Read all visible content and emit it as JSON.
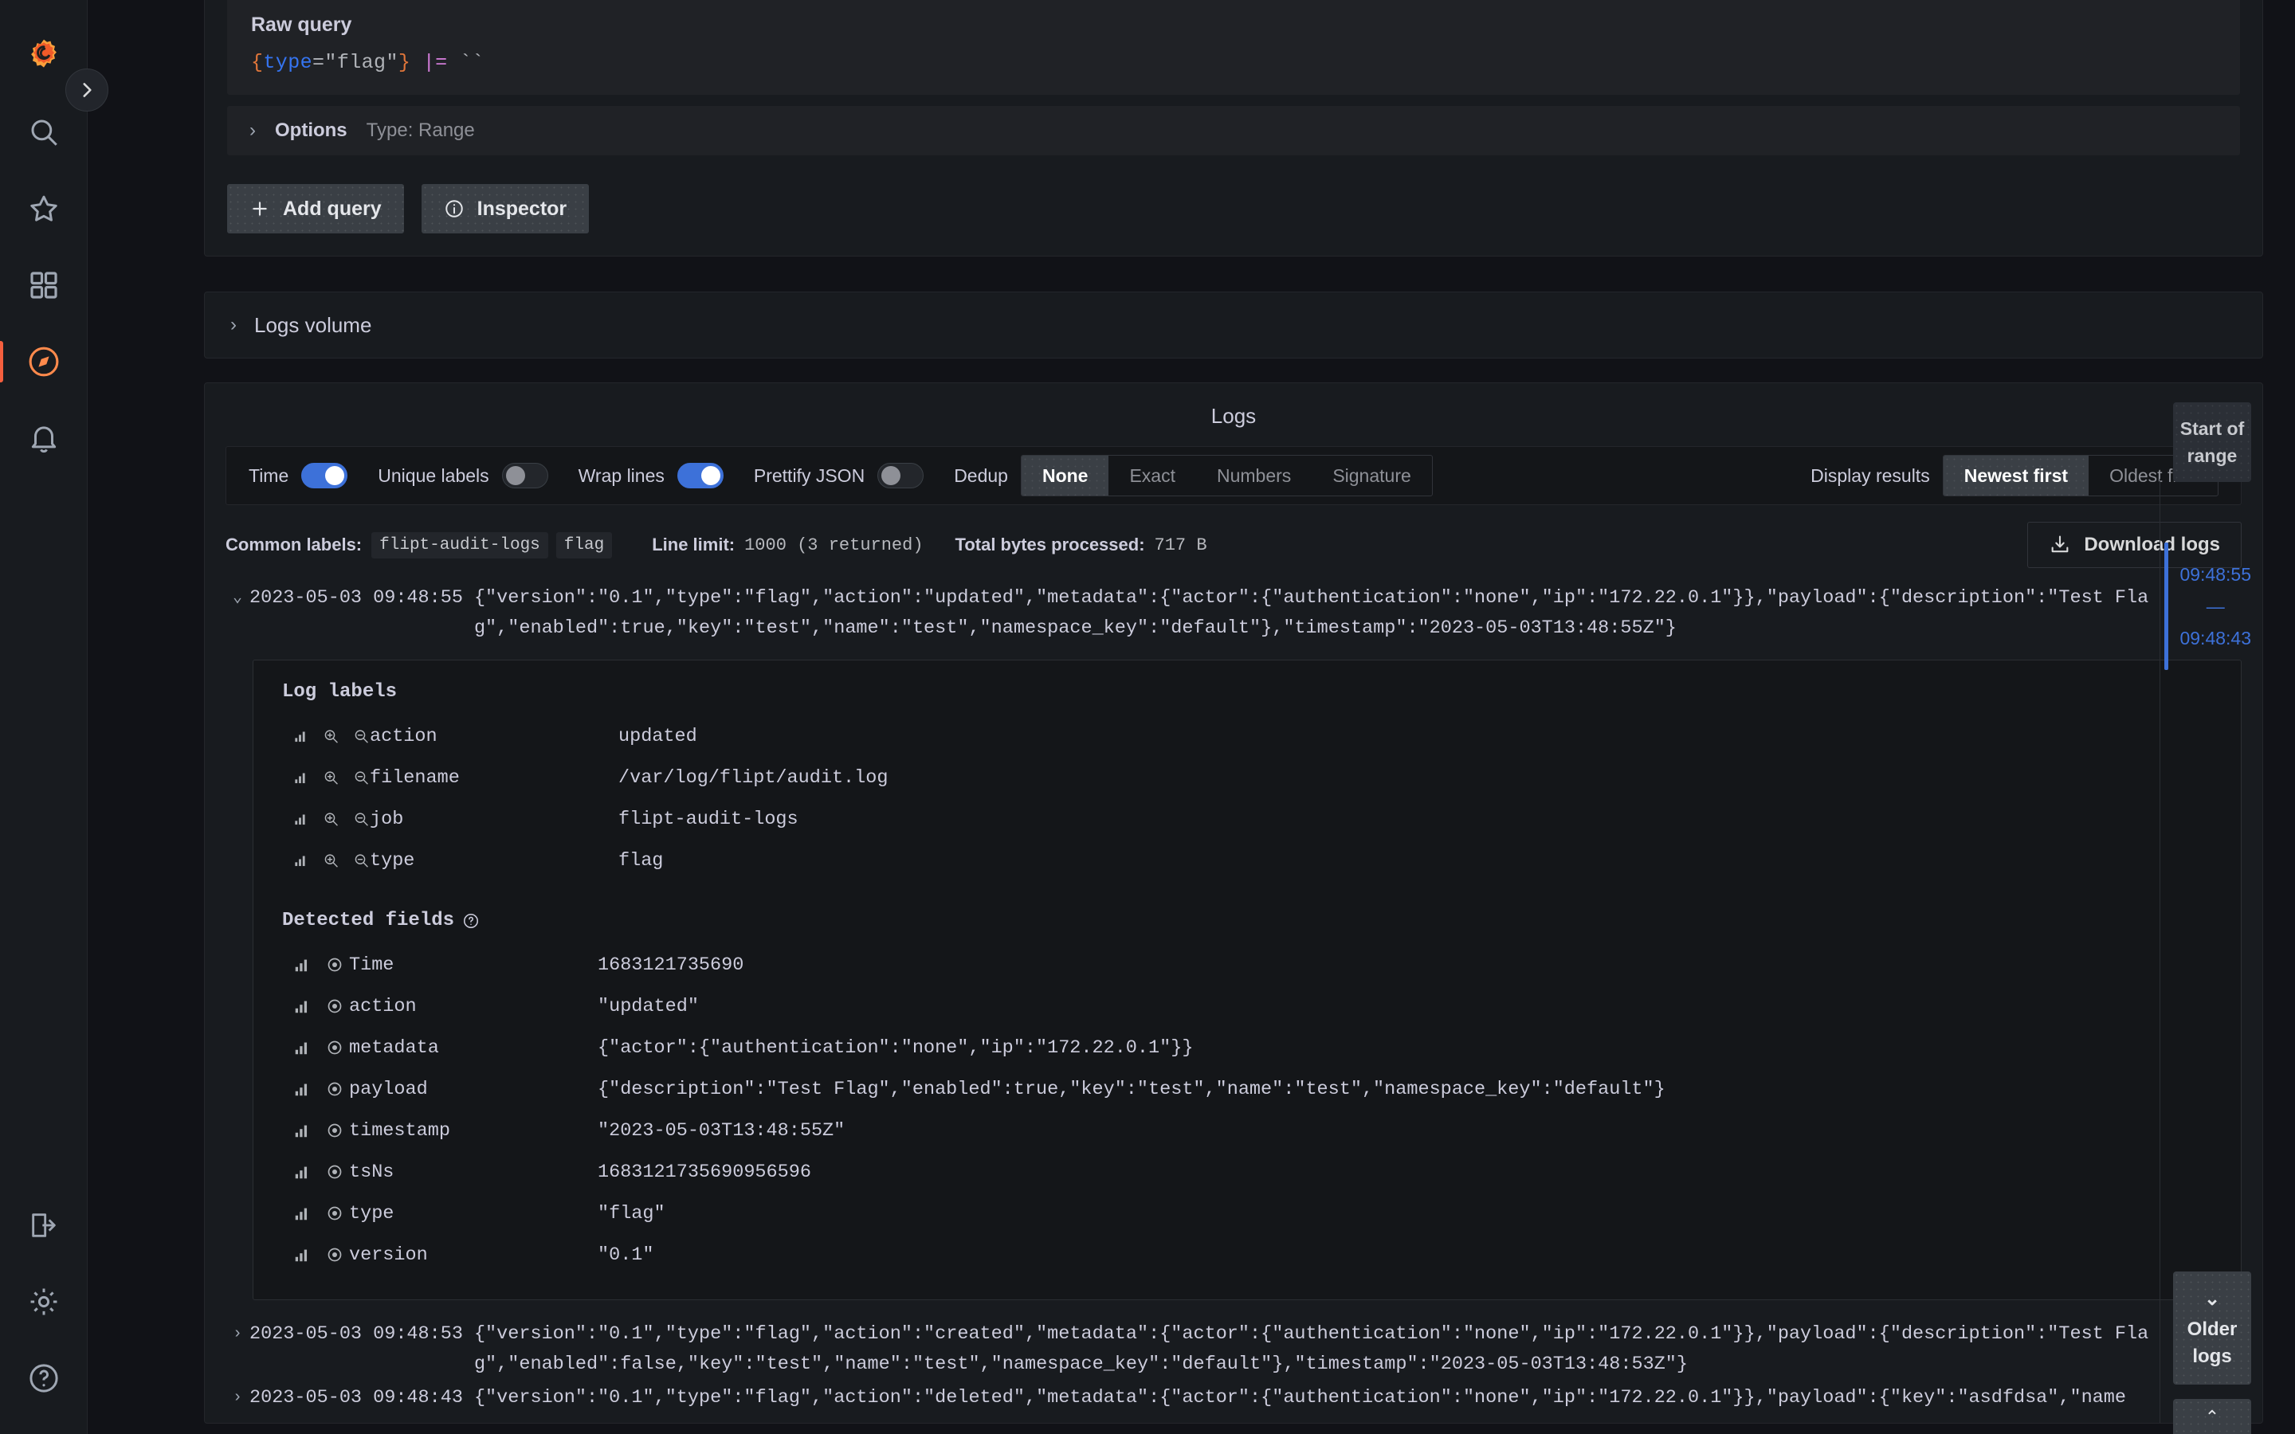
{
  "sidebar": {
    "items": [
      {
        "name": "grafana-logo",
        "label": "Grafana"
      },
      {
        "name": "search",
        "label": "Search"
      },
      {
        "name": "starred",
        "label": "Starred"
      },
      {
        "name": "dashboards",
        "label": "Dashboards"
      },
      {
        "name": "explore",
        "label": "Explore"
      },
      {
        "name": "alerting",
        "label": "Alerting"
      }
    ],
    "bottom_items": [
      {
        "name": "sign-in",
        "label": "Sign in"
      },
      {
        "name": "configuration",
        "label": "Configuration"
      },
      {
        "name": "help",
        "label": "Help"
      }
    ]
  },
  "query_editor": {
    "raw_query_label": "Raw query",
    "raw_query": {
      "open_brace": "{",
      "key": "type",
      "eq_quote": "=\"",
      "value": "flag",
      "close_quote": "\"",
      "close_brace": "}",
      "operator": "|=",
      "filter": "``",
      "full": "{type=\"flag\"} |= ``"
    },
    "options_label": "Options",
    "options_meta": "Type: Range",
    "add_query_label": "Add query",
    "inspector_label": "Inspector"
  },
  "logs_volume": {
    "title": "Logs volume"
  },
  "logs_panel": {
    "title": "Logs",
    "toggles": [
      {
        "label": "Time",
        "on": true
      },
      {
        "label": "Unique labels",
        "on": false
      },
      {
        "label": "Wrap lines",
        "on": true
      },
      {
        "label": "Prettify JSON",
        "on": false
      }
    ],
    "dedup": {
      "label": "Dedup",
      "options": [
        "None",
        "Exact",
        "Numbers",
        "Signature"
      ],
      "selected": "None"
    },
    "display_results": {
      "label": "Display results",
      "options": [
        "Newest first",
        "Oldest first"
      ],
      "selected": "Newest first"
    },
    "meta": {
      "common_labels_label": "Common labels:",
      "common_labels": [
        "flipt-audit-logs",
        "flag"
      ],
      "line_limit_label": "Line limit:",
      "line_limit_value": "1000 (3 returned)",
      "bytes_label": "Total bytes processed:",
      "bytes_value": "717 B",
      "download_label": "Download logs"
    },
    "gutter": {
      "start_of_range": "Start of range",
      "range_top_time": "09:48:55",
      "range_dash": "—",
      "range_bottom_time": "09:48:43",
      "older_logs": "Older logs"
    }
  },
  "log_entries": [
    {
      "expanded": true,
      "caret": "⌄",
      "timestamp": "2023-05-03 09:48:55",
      "message": "{\"version\":\"0.1\",\"type\":\"flag\",\"action\":\"updated\",\"metadata\":{\"actor\":{\"authentication\":\"none\",\"ip\":\"172.22.0.1\"}},\"payload\":{\"description\":\"Test Flag\",\"enabled\":true,\"key\":\"test\",\"name\":\"test\",\"namespace_key\":\"default\"},\"timestamp\":\"2023-05-03T13:48:55Z\"}",
      "detail": {
        "log_labels_title": "Log labels",
        "log_labels": [
          {
            "key": "action",
            "value": "updated"
          },
          {
            "key": "filename",
            "value": "/var/log/flipt/audit.log"
          },
          {
            "key": "job",
            "value": "flipt-audit-logs"
          },
          {
            "key": "type",
            "value": "flag"
          }
        ],
        "detected_fields_title": "Detected fields",
        "detected_fields": [
          {
            "key": "Time",
            "value": "1683121735690"
          },
          {
            "key": "action",
            "value": "\"updated\""
          },
          {
            "key": "metadata",
            "value": "{\"actor\":{\"authentication\":\"none\",\"ip\":\"172.22.0.1\"}}"
          },
          {
            "key": "payload",
            "value": "{\"description\":\"Test Flag\",\"enabled\":true,\"key\":\"test\",\"name\":\"test\",\"namespace_key\":\"default\"}"
          },
          {
            "key": "timestamp",
            "value": "\"2023-05-03T13:48:55Z\""
          },
          {
            "key": "tsNs",
            "value": "1683121735690956596"
          },
          {
            "key": "type",
            "value": "\"flag\""
          },
          {
            "key": "version",
            "value": "\"0.1\""
          }
        ]
      }
    },
    {
      "expanded": false,
      "caret": "›",
      "timestamp": "2023-05-03 09:48:53",
      "message": "{\"version\":\"0.1\",\"type\":\"flag\",\"action\":\"created\",\"metadata\":{\"actor\":{\"authentication\":\"none\",\"ip\":\"172.22.0.1\"}},\"payload\":{\"description\":\"Test Flag\",\"enabled\":false,\"key\":\"test\",\"name\":\"test\",\"namespace_key\":\"default\"},\"timestamp\":\"2023-05-03T13:48:53Z\"}"
    },
    {
      "expanded": false,
      "caret": "›",
      "timestamp": "2023-05-03 09:48:43",
      "message": "{\"version\":\"0.1\",\"type\":\"flag\",\"action\":\"deleted\",\"metadata\":{\"actor\":{\"authentication\":\"none\",\"ip\":\"172.22.0.1\"}},\"payload\":{\"key\":\"asdfdsa\",\"name"
    }
  ],
  "colors": {
    "accent_blue": "#3d71d9",
    "brand_orange": "#f55f3e",
    "panel_bg": "#181b1f",
    "app_bg": "#111217"
  }
}
